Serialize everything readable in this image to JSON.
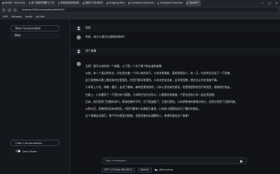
{
  "browser": {
    "tabs": [
      {
        "label": "Reddit - Dive into"
      },
      {
        "label": "像人类那样理解上下文"
      },
      {
        "label": "哈哈哈哈哈哈哈哈"
      },
      {
        "label": "微软XP 的AI助手"
      },
      {
        "label": "Hugging Face"
      },
      {
        "label": "Instagram Business"
      },
      {
        "label": "Instagram Business"
      },
      {
        "label": "TypeGPT",
        "active": true
      }
    ],
    "url": "localhost:3000/conversations/0c6d5f7a",
    "bookmarks": [
      "OEM",
      "Wikipedia",
      "Reddit",
      "YouTube"
    ]
  },
  "sidebar": {
    "new_conversation_label": "New Conversation",
    "conversations": [
      "Web"
    ],
    "clear_conversations_label": "Clear Conversations",
    "dark_mode_label": "Dark Mode"
  },
  "chat": {
    "user_message_1": "你好",
    "bot_message_1": "你好，有什么我可以帮助你的吗？",
    "user_message_2": "讲个故事",
    "response_paragraphs": [
      "当然！我可以给你讲一个故事。以下是一个关于勇气和友谊的故事：",
      "从前，有一个遥远的村庄，村庄里住着一个叫小米的孩子。小米非常勇敢，喜欢帮助别人。有一天，村庄附近出现了一只怪兽。",
      "这只怪兽每天晚上都会来村庄里捣乱，村民们都非常害怕。小米决定站出来，去寻找怪兽，想办法让村庄恢复平静。",
      "小米背上小包，带着一盏灯，走进了森林。森林里黑漆漆的，小米心里也有些紧张，但是他想到村民们的笑脸，就继续往前走。",
      "在路上，小米遇到了一只受伤的小狐狸。小米帮它包扎好伤口，小狐狸非常感激，于是决定陪小米一起去找怪兽。",
      "后来，他们找到了怪兽的洞穴。原来怪兽并不坏，它只是迷路了，又饿又害怕。小米把带来的食物分给它，还帮它找到了回家的路。",
      "从那以后，怪兽再也没有来捣乱。村民们都夸小米勇敢又善良，小米和小狐狸也成为了最好的朋友。",
      "这个故事告诉我们，勇气不仅是面对困难，也是用善良去理解别人。希望你喜欢这个故事！"
    ],
    "input_placeholder": "Type a message...",
    "model_label": "GPT 3.5 Turbo 16k 0613",
    "mode_label": "Default",
    "web_access_label": "Web Access"
  }
}
